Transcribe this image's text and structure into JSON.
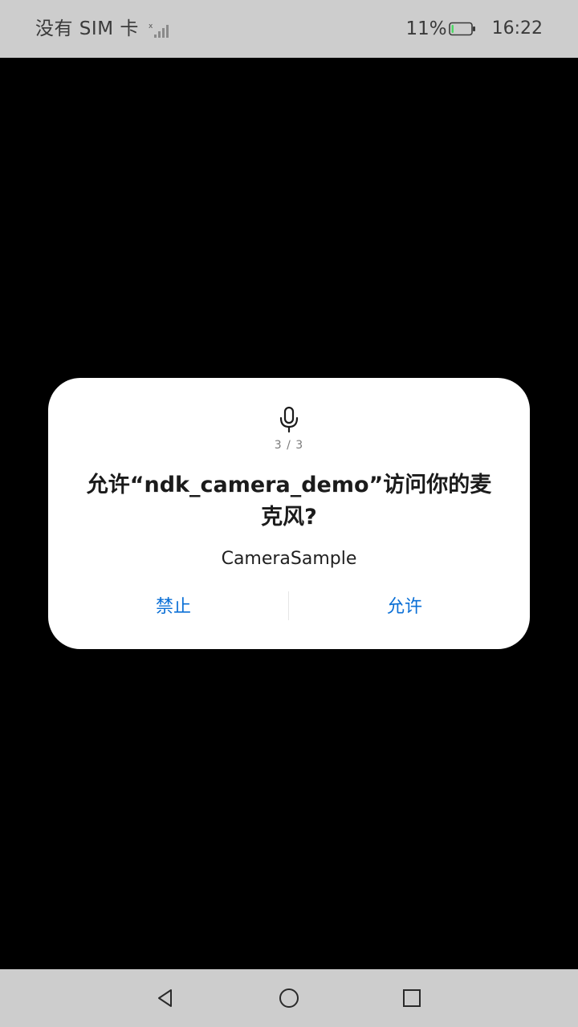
{
  "status_bar": {
    "carrier": "没有 SIM 卡",
    "signal_icon": "signal-weak-icon",
    "battery_percent": "11%",
    "battery_icon": "battery-low-icon",
    "battery_level": 0.11,
    "battery_fill_color": "#4cd964",
    "time": "16:22",
    "background_color": "#cdcdcd",
    "text_color": "#3a3a3a"
  },
  "screen": {
    "background_color": "#000000"
  },
  "dialog": {
    "icon": "microphone-icon",
    "page_indicator": "3 / 3",
    "title": "允许“ndk_camera_demo”访问你的麦克风?",
    "app_name": "CameraSample",
    "deny_label": "禁止",
    "allow_label": "允许",
    "accent_color": "#0a6fd6",
    "background_color": "#ffffff"
  },
  "nav_bar": {
    "back_icon": "back-triangle-icon",
    "home_icon": "home-circle-icon",
    "recent_icon": "recent-square-icon",
    "background_color": "#cdcdcd"
  }
}
